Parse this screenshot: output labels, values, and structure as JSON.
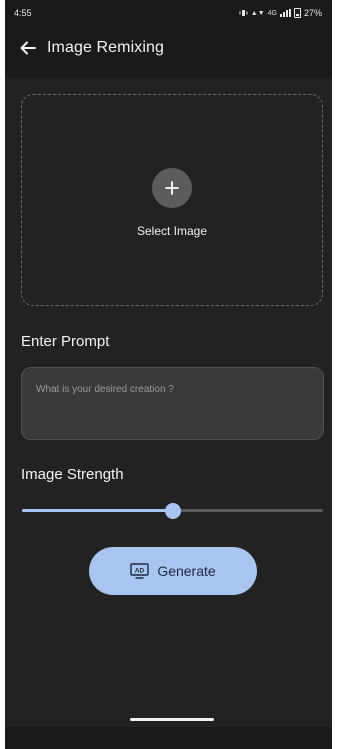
{
  "status_bar": {
    "time": "4:55",
    "network": "4G",
    "battery": "27%"
  },
  "app_bar": {
    "title": "Image Remixing",
    "back_icon": "arrow-left-icon"
  },
  "image_picker": {
    "add_icon": "plus-icon",
    "label": "Select Image"
  },
  "prompt": {
    "label": "Enter Prompt",
    "placeholder": "What is your desired creation ?",
    "value": ""
  },
  "strength": {
    "label": "Image Strength",
    "value": 0.5
  },
  "generate": {
    "label": "Generate",
    "icon": "ad-icon"
  },
  "colors": {
    "accent": "#a9c4ee",
    "background": "#222222",
    "app_bar": "#1a1a1a"
  }
}
